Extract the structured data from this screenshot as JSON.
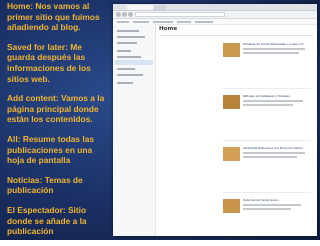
{
  "notes": [
    "Home: Nos vamos al primer sitio que fuimos añadiendo al blog.",
    "Saved for later: Me guarda después las informaciones de los sitios web.",
    "Add content: Vamos a la página principal donde están los contenidos.",
    "All: Resume todas las publicaciones en una hoja de pantalla",
    "Noticias: Temas de publicación",
    "El Espectador: Sitio donde se añade a la publicación"
  ],
  "screenshot": {
    "page_title": "Home",
    "posts": [
      {
        "title": "Chuletas de Cerdo Rebozadas y a que no?",
        "thumb_color": "#c99a4b"
      },
      {
        "title": "Milhojas de Calabacín y Tomates",
        "thumb_color": "#b8833a"
      },
      {
        "title": "Alcachofa Sabrosura con Dion con Salmo",
        "thumb_color": "#d4a056"
      },
      {
        "title": "Cebe Hoven Verde Hotes",
        "thumb_color": "#c7944a"
      }
    ]
  },
  "colors": {
    "notes_text": "#f2b531",
    "slide_bg": "#1a2f63"
  }
}
